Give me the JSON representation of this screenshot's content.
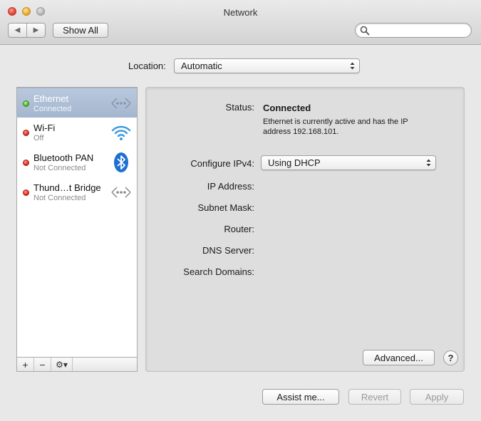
{
  "window": {
    "title": "Network"
  },
  "toolbar": {
    "back_icon": "back-arrow-icon",
    "forward_icon": "forward-arrow-icon",
    "show_all_label": "Show All",
    "search_placeholder": "",
    "search_icon": "search-icon"
  },
  "location": {
    "label": "Location:",
    "selected": "Automatic"
  },
  "services": [
    {
      "name": "Ethernet",
      "status": "Connected",
      "indicator": "green",
      "icon": "ethernet-icon",
      "selected": true
    },
    {
      "name": "Wi-Fi",
      "status": "Off",
      "indicator": "red",
      "icon": "wifi-icon",
      "selected": false
    },
    {
      "name": "Bluetooth PAN",
      "status": "Not Connected",
      "indicator": "red",
      "icon": "bluetooth-icon",
      "selected": false
    },
    {
      "name": "Thund…t Bridge",
      "status": "Not Connected",
      "indicator": "red",
      "icon": "ethernet-icon",
      "selected": false
    }
  ],
  "sidebar_footer": {
    "add": "+",
    "remove": "−",
    "gear": "⚙▾"
  },
  "details": {
    "status_label": "Status:",
    "status_value": "Connected",
    "status_description": "Ethernet is currently active and has the IP address 192.168.101.",
    "configure_label": "Configure IPv4:",
    "configure_value": "Using DHCP",
    "ip_label": "IP Address:",
    "subnet_label": "Subnet Mask:",
    "router_label": "Router:",
    "dns_label": "DNS Server:",
    "search_domains_label": "Search Domains:",
    "advanced_label": "Advanced...",
    "help_label": "?"
  },
  "buttons": {
    "assist": "Assist me...",
    "revert": "Revert",
    "apply": "Apply"
  },
  "colors": {
    "selected_row": "#a9bad2",
    "status_green": "#4fb821",
    "status_red": "#e02b1f",
    "panel_bg": "#dedede",
    "window_bg": "#e8e8e8"
  }
}
